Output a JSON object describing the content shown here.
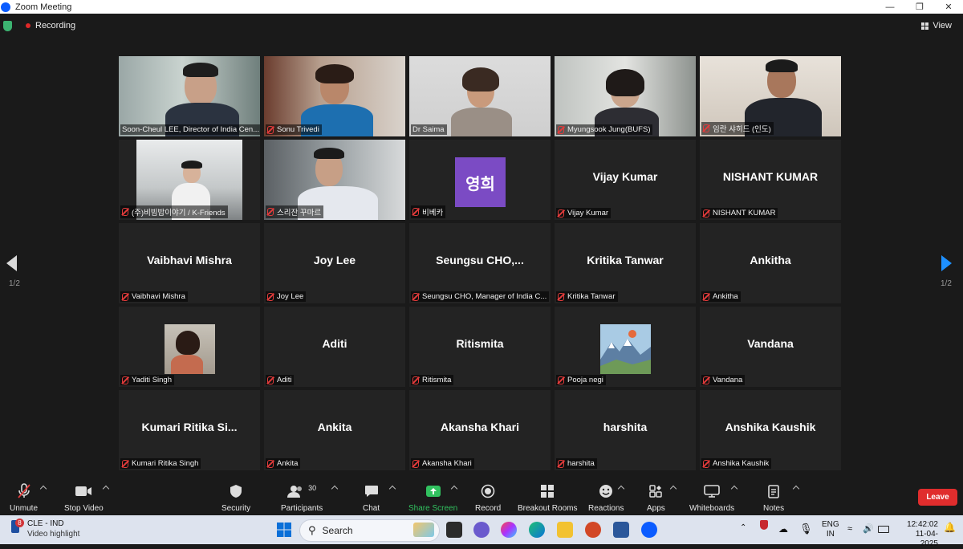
{
  "window": {
    "title": "Zoom Meeting"
  },
  "topbar": {
    "recording_label": "Recording",
    "view_label": "View"
  },
  "gallery": {
    "page": "1/2",
    "tiles": [
      {
        "label": "Soon-Cheul LEE, Director of India Cen...",
        "big": "",
        "muted": false
      },
      {
        "label": "Sonu Trivedi",
        "big": "",
        "muted": true
      },
      {
        "label": "Dr Saima",
        "big": "",
        "muted": false
      },
      {
        "label": "Myungsook Jung(BUFS)",
        "big": "",
        "muted": true
      },
      {
        "label": "임란 샤히드 (인도)",
        "big": "",
        "muted": true
      },
      {
        "label": "(주)비빔밥이야기 / K-Friends",
        "big": "",
        "muted": true
      },
      {
        "label": "스리잔 꾸마르",
        "big": "",
        "muted": true
      },
      {
        "label": "비베카",
        "big": "",
        "muted": true,
        "avatar_text": "영희"
      },
      {
        "label": "Vijay Kumar",
        "big": "Vijay Kumar",
        "muted": true
      },
      {
        "label": "NISHANT KUMAR",
        "big": "NISHANT KUMAR",
        "muted": true
      },
      {
        "label": "Vaibhavi Mishra",
        "big": "Vaibhavi Mishra",
        "muted": true
      },
      {
        "label": "Joy Lee",
        "big": "Joy Lee",
        "muted": true
      },
      {
        "label": "Seungsu CHO, Manager of India C...",
        "big": "Seungsu CHO,...",
        "muted": true
      },
      {
        "label": "Kritika Tanwar",
        "big": "Kritika Tanwar",
        "muted": true
      },
      {
        "label": "Ankitha",
        "big": "Ankitha",
        "muted": true
      },
      {
        "label": "Yaditi Singh",
        "big": "",
        "muted": true
      },
      {
        "label": "Aditi",
        "big": "Aditi",
        "muted": true
      },
      {
        "label": "Ritismita",
        "big": "Ritismita",
        "muted": true
      },
      {
        "label": "Pooja negi",
        "big": "",
        "muted": true
      },
      {
        "label": "Vandana",
        "big": "Vandana",
        "muted": true
      },
      {
        "label": "Kumari Ritika Singh",
        "big": "Kumari  Ritika  Si...",
        "muted": true
      },
      {
        "label": "Ankita",
        "big": "Ankita",
        "muted": true
      },
      {
        "label": "Akansha Khari",
        "big": "Akansha Khari",
        "muted": true
      },
      {
        "label": "harshita",
        "big": "harshita",
        "muted": true
      },
      {
        "label": "Anshika Kaushik",
        "big": "Anshika Kaushik",
        "muted": true
      }
    ]
  },
  "toolbar": {
    "unmute": "Unmute",
    "stop_video": "Stop Video",
    "security": "Security",
    "participants": "Participants",
    "participants_count": "30",
    "chat": "Chat",
    "share_screen": "Share Screen",
    "record": "Record",
    "breakout_rooms": "Breakout Rooms",
    "reactions": "Reactions",
    "apps": "Apps",
    "whiteboards": "Whiteboards",
    "notes": "Notes",
    "leave": "Leave"
  },
  "taskbar": {
    "notification_count": "8",
    "match_title": "CLE - IND",
    "match_subtitle": "Video highlight",
    "search_placeholder": "Search",
    "lang_top": "ENG",
    "lang_bottom": "IN",
    "time": "12:42:02",
    "date": "11-04-2025"
  },
  "colors": {
    "accent_blue": "#0b5cff",
    "leave_red": "#e02d2d",
    "share_green": "#31c15f",
    "active_speaker": "#e6e04a"
  }
}
